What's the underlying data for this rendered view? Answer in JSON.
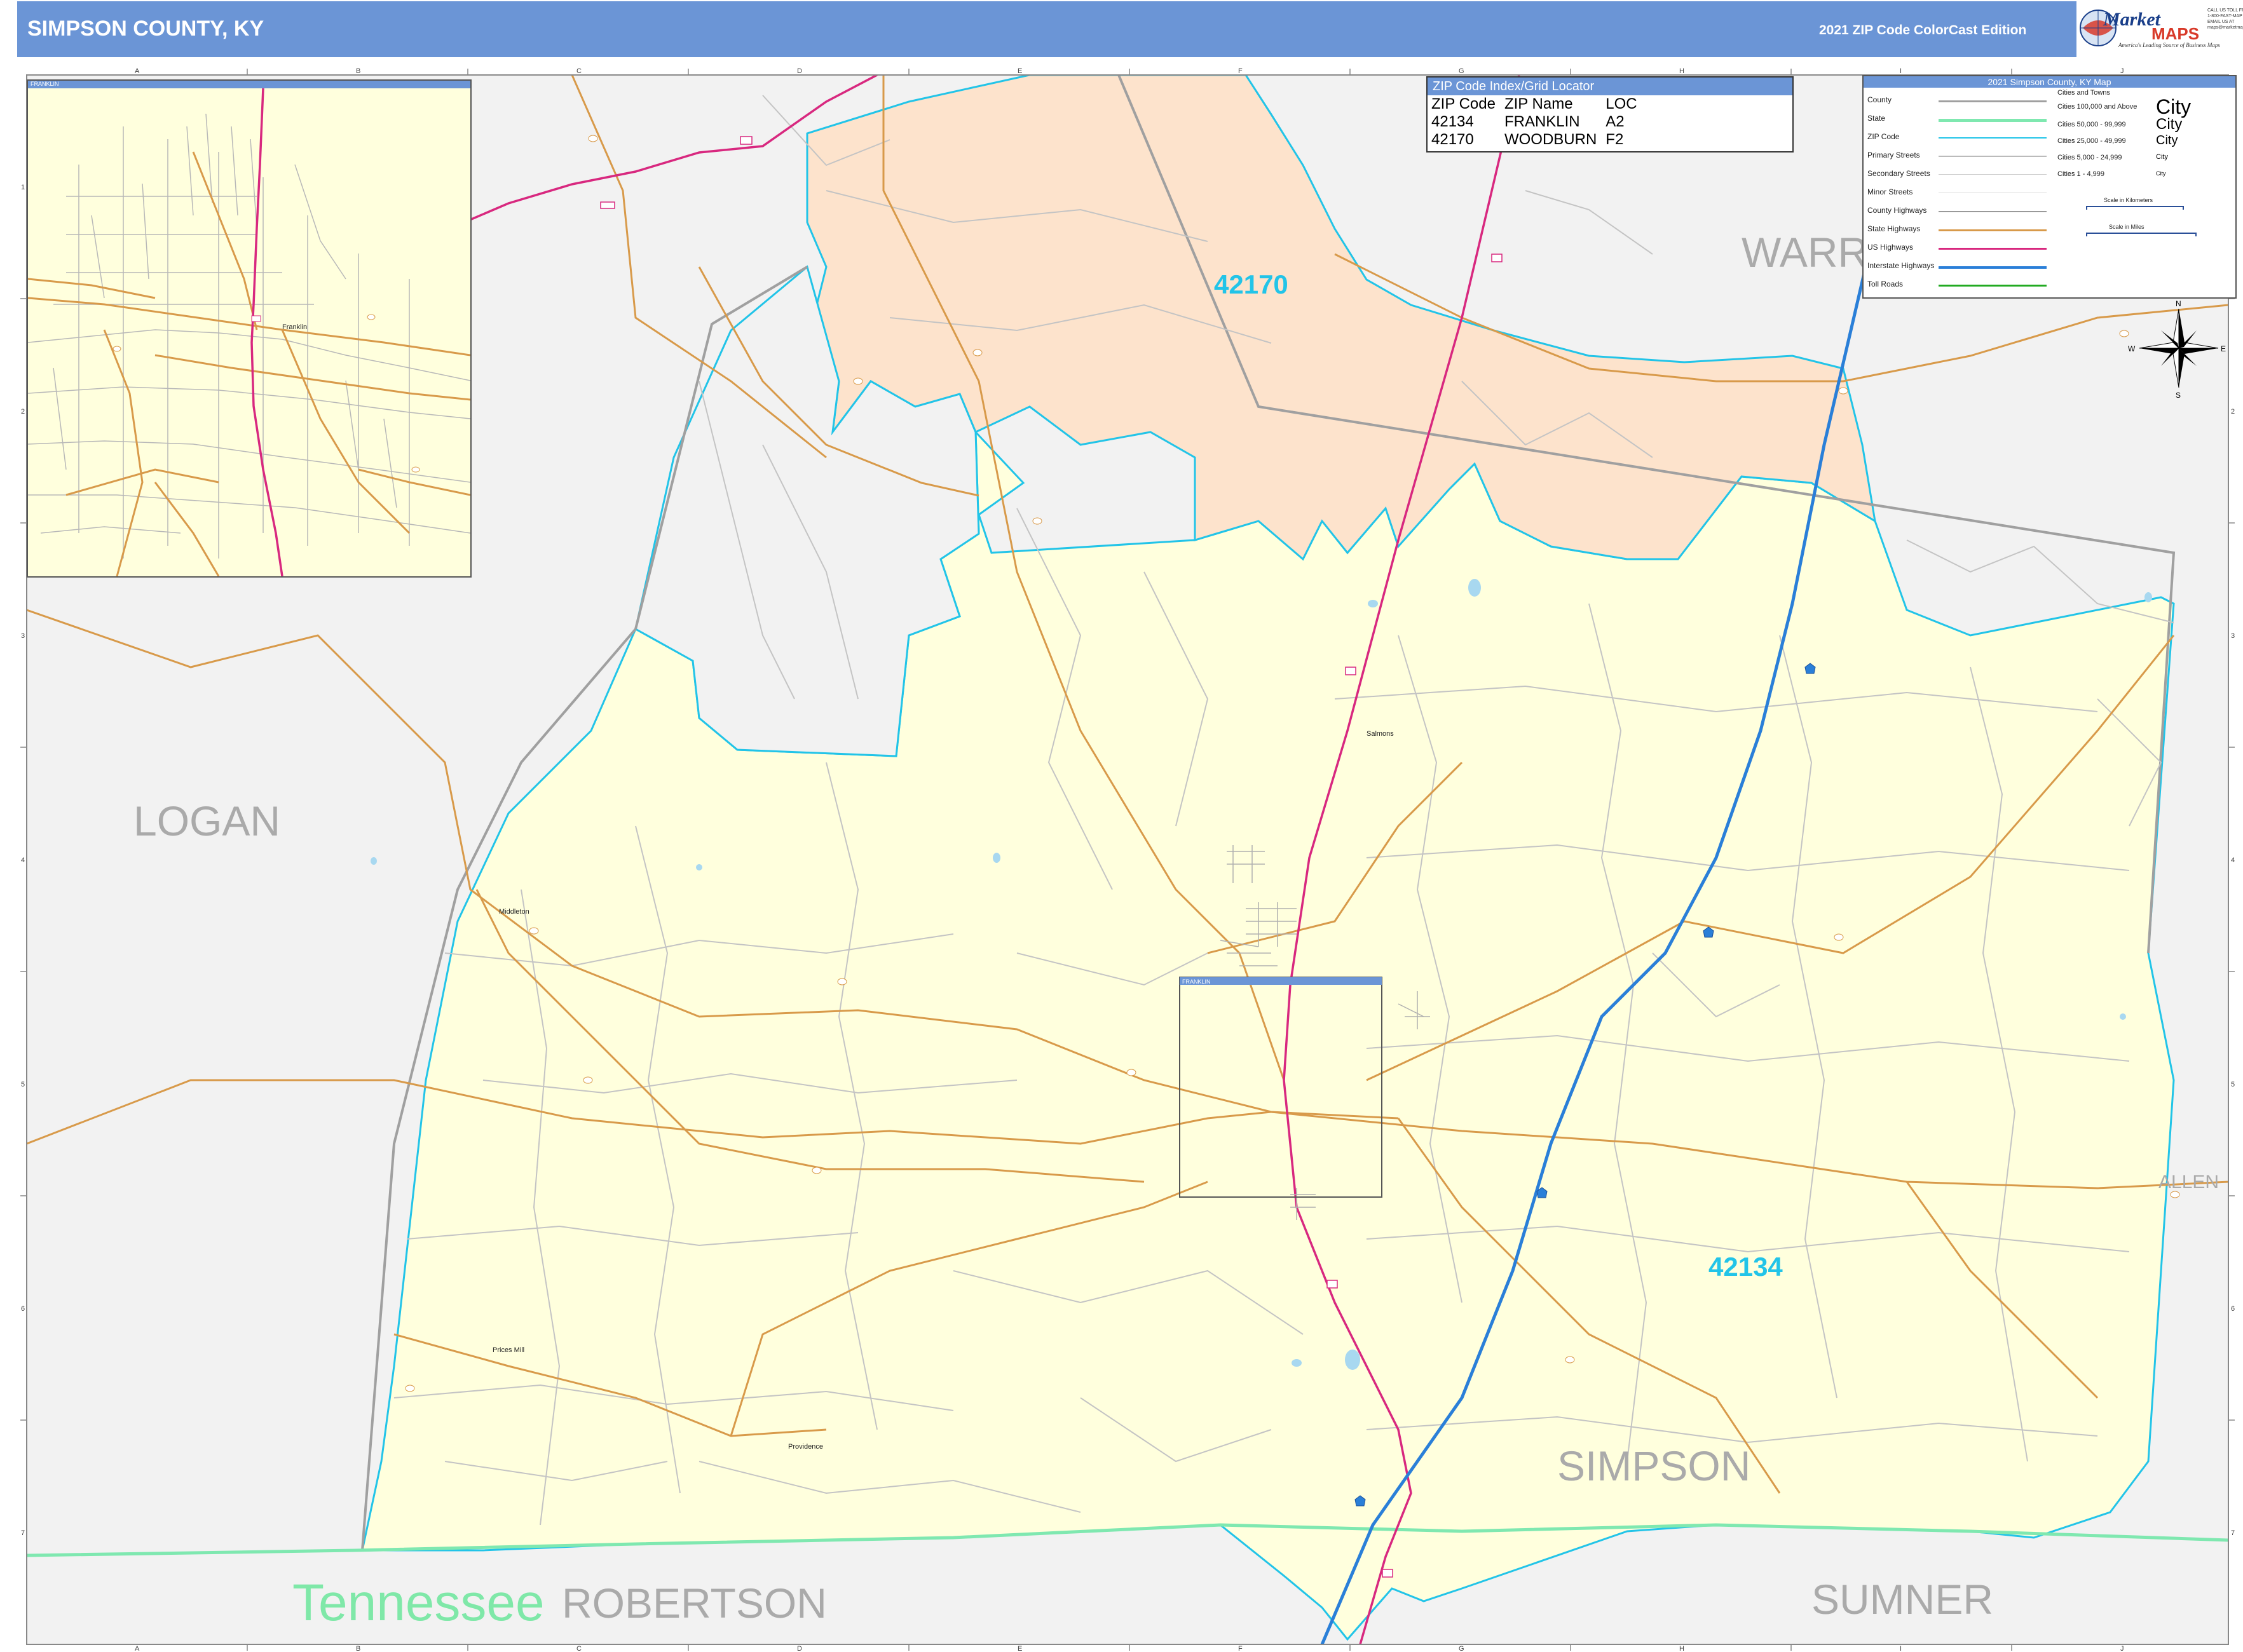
{
  "header": {
    "title": "SIMPSON COUNTY, KY",
    "edition": "2021 ZIP Code ColorCast Edition"
  },
  "logo": {
    "brand_a": "Market",
    "brand_b": "MAPS",
    "tagline": "America's Leading Source of Business Maps",
    "contact": [
      "CALL US TOLL FREE",
      "1-800-FAST-MAP (327)",
      "EMAIL US AT",
      "maps@marketmaps.com"
    ]
  },
  "colors": {
    "header_bar": "#6b95d6",
    "zip_42134": "#ffffdd",
    "zip_42170": "#fde3cc",
    "outside_county": "#f2f2f2",
    "zip_boundary": "#22c4e8",
    "county_boundary": "#a0a0a0",
    "state_line": "#7fe8b0",
    "interstate": "#2a7fd8",
    "us_highway": "#d8287f",
    "state_highway": "#d89a4a",
    "zip_label": "#22c4e8",
    "county_label": "#aaaaaa",
    "state_label": "#7fe8a8"
  },
  "counties": {
    "warren": "WARREN",
    "logan": "LOGAN",
    "simpson": "SIMPSON",
    "allen": "ALLEN",
    "robertson": "ROBERTSON",
    "sumner": "SUMNER"
  },
  "state_label": "Tennessee",
  "zip_labels": {
    "north": "42170",
    "south": "42134"
  },
  "towns": {
    "franklin": "Franklin",
    "simmons": "Salmons",
    "middleton": "Middleton",
    "prices_mill": "Prices Mill",
    "providence": "Providence"
  },
  "inset": {
    "title": "FRANKLIN",
    "town": "Franklin"
  },
  "frame_box_label": "FRANKLIN",
  "zip_index": {
    "title": "ZIP Code Index/Grid Locator",
    "columns": [
      "ZIP Code",
      "ZIP Name",
      "LOC"
    ],
    "rows": [
      [
        "42134",
        "FRANKLIN",
        "A2"
      ],
      [
        "42170",
        "WOODBURN",
        "F2"
      ]
    ]
  },
  "legend": {
    "title": "2021 Simpson County, KY Map",
    "items": [
      {
        "label": "County",
        "color": "#a0a0a0"
      },
      {
        "label": "State",
        "color": "#7fe8b0"
      },
      {
        "label": "ZIP Code",
        "color": "#22c4e8"
      },
      {
        "label": "Primary Streets",
        "color": "#bbbbbb"
      },
      {
        "label": "Secondary Streets",
        "color": "#cccccc"
      },
      {
        "label": "Minor Streets",
        "color": "#dddddd"
      },
      {
        "label": "County Highways",
        "color": "#999999"
      },
      {
        "label": "State Highways",
        "color": "#d89a4a"
      },
      {
        "label": "US Highways",
        "color": "#d8287f"
      },
      {
        "label": "Interstate Highways",
        "color": "#2a7fd8"
      },
      {
        "label": "Toll Roads",
        "color": "#22aa22"
      }
    ],
    "cities_header": "Cities and Towns",
    "cities": [
      {
        "label": "Cities 100,000 and Above",
        "sample": "City"
      },
      {
        "label": "Cities 50,000 - 99,999",
        "sample": "City"
      },
      {
        "label": "Cities 25,000 - 49,999",
        "sample": "City"
      },
      {
        "label": "Cities 5,000 - 24,999",
        "sample": "City"
      },
      {
        "label": "Cities 1 - 4,999",
        "sample": "City"
      }
    ],
    "scale_km": "Scale in Kilometers",
    "scale_mi": "Scale in Miles"
  },
  "compass": {
    "n": "N",
    "s": "S",
    "e": "E",
    "w": "W"
  },
  "grid": {
    "columns": [
      "A",
      "B",
      "C",
      "D",
      "E",
      "F",
      "G",
      "H",
      "I",
      "J"
    ],
    "rows": [
      "1",
      "2",
      "3",
      "4",
      "5",
      "6",
      "7"
    ]
  },
  "route_shields": [
    "31W",
    "1008",
    "100",
    "73",
    "65",
    "383",
    "585",
    "1171",
    "884",
    "1885"
  ]
}
